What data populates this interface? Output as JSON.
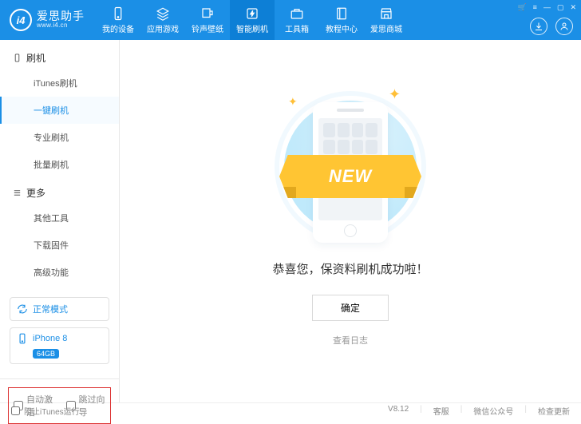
{
  "brand": {
    "cn": "爱思助手",
    "en": "www.i4.cn",
    "logo_letters": "i4"
  },
  "nav": [
    {
      "label": "我的设备",
      "icon": "phone"
    },
    {
      "label": "应用游戏",
      "icon": "apps"
    },
    {
      "label": "铃声壁纸",
      "icon": "ringtone"
    },
    {
      "label": "智能刷机",
      "icon": "flash"
    },
    {
      "label": "工具箱",
      "icon": "toolbox"
    },
    {
      "label": "教程中心",
      "icon": "book"
    },
    {
      "label": "爱思商城",
      "icon": "store"
    }
  ],
  "nav_active_index": 3,
  "sidebar": {
    "groups": [
      {
        "title": "刷机",
        "icon": "device",
        "items": [
          "iTunes刷机",
          "一键刷机",
          "专业刷机",
          "批量刷机"
        ],
        "active_index": 1
      },
      {
        "title": "更多",
        "icon": "list",
        "items": [
          "其他工具",
          "下载固件",
          "高级功能"
        ],
        "active_index": -1
      }
    ]
  },
  "mode": {
    "label": "正常模式",
    "icon": "refresh"
  },
  "device": {
    "icon": "phone-outline",
    "name": "iPhone 8",
    "badge": "64GB"
  },
  "red_box": {
    "auto_activate": {
      "label": "自动激活",
      "checked": false
    },
    "skip_guide": {
      "label": "跳过向导",
      "checked": false
    }
  },
  "main": {
    "ribbon_text": "NEW",
    "message": "恭喜您，保资料刷机成功啦！",
    "ok_label": "确定",
    "log_label": "查看日志"
  },
  "statusbar": {
    "stop_itunes": {
      "label": "阻止iTunes运行",
      "checked": false
    },
    "version": "V8.12",
    "support": "客服",
    "wechat": "微信公众号",
    "check_update": "检查更新"
  }
}
